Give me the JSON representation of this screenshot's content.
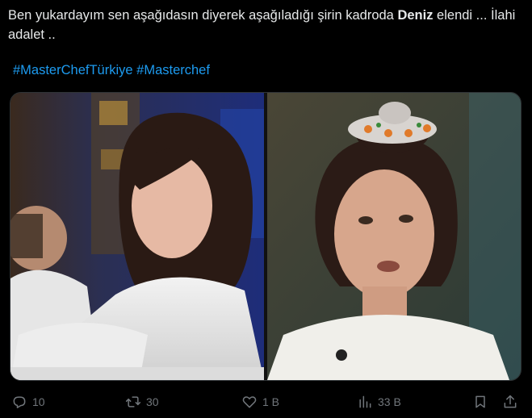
{
  "tweet": {
    "text_before": "Ben yukardayım sen aşağıdasın diyerek aşağıladığı şirin kadroda ",
    "text_bold": "Deniz",
    "text_after": " elendi ... İlahi adalet ..",
    "hashtags": [
      "#MasterChefTürkiye",
      "#Masterchef"
    ]
  },
  "actions": {
    "replies": "10",
    "reposts": "30",
    "likes": "1 B",
    "views": "33 B"
  },
  "icons": {
    "reply": "speech-bubble-icon",
    "repost": "repost-arrows-icon",
    "like": "heart-icon",
    "views": "bar-chart-icon",
    "bookmark": "bookmark-icon",
    "share": "share-upload-icon"
  },
  "colors": {
    "background": "#000000",
    "text": "#e7e9ea",
    "link": "#1d9bf0",
    "muted": "#71767b"
  }
}
